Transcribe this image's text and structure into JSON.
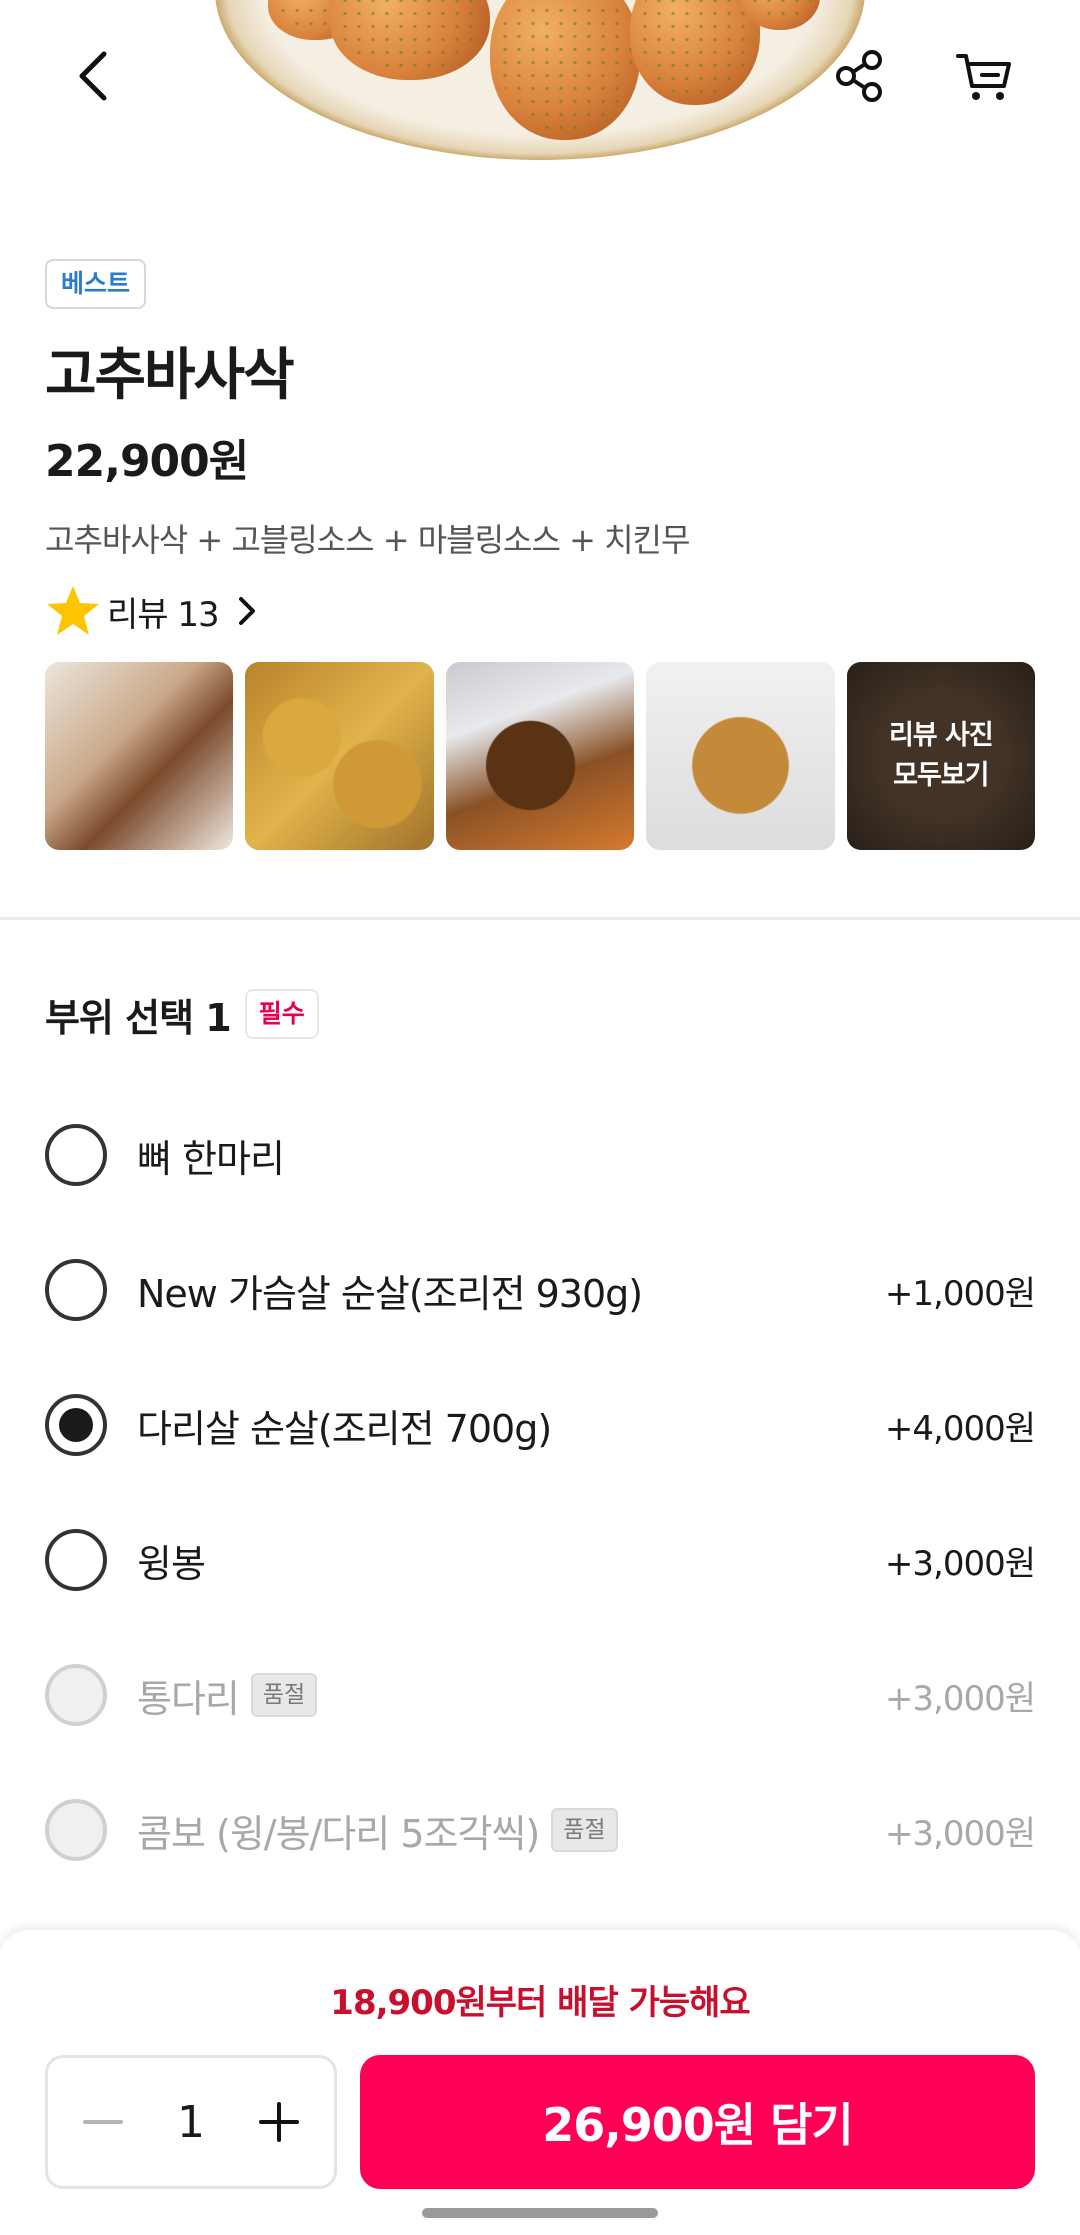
{
  "header": {
    "back_icon": "chevron-left-icon",
    "share_icon": "share-icon",
    "cart_icon": "cart-icon"
  },
  "product": {
    "badge": "베스트",
    "name": "고추바사삭",
    "price": "22,900원",
    "description": "고추바사삭 + 고블링소스 + 마블링소스 + 치킨무",
    "review_label": "리뷰 13",
    "review_more_label": "리뷰 사진\n모두보기"
  },
  "options": {
    "title": "부위 선택 1",
    "required_badge": "필수",
    "items": [
      {
        "label": "뼈 한마리",
        "price": "",
        "state": "unselected"
      },
      {
        "label": "New 가슴살 순살(조리전 930g)",
        "price": "+1,000원",
        "state": "unselected"
      },
      {
        "label": "다리살 순살(조리전 700g)",
        "price": "+4,000원",
        "state": "selected"
      },
      {
        "label": "윙봉",
        "price": "+3,000원",
        "state": "unselected"
      },
      {
        "label": "통다리",
        "price": "+3,000원",
        "state": "disabled",
        "badge": "품절"
      },
      {
        "label": "콤보 (윙/봉/다리 5조각씩)",
        "price": "+3,000원",
        "state": "disabled",
        "badge": "품절"
      }
    ]
  },
  "bottom": {
    "min_order_text": "18,900원부터 배달 가능해요",
    "quantity": "1",
    "add_button_label": "26,900원 담기"
  },
  "colors": {
    "accent": "#ff0055",
    "min_order": "#c8102e",
    "best_badge": "#2a7bd0",
    "required": "#e8004f"
  }
}
